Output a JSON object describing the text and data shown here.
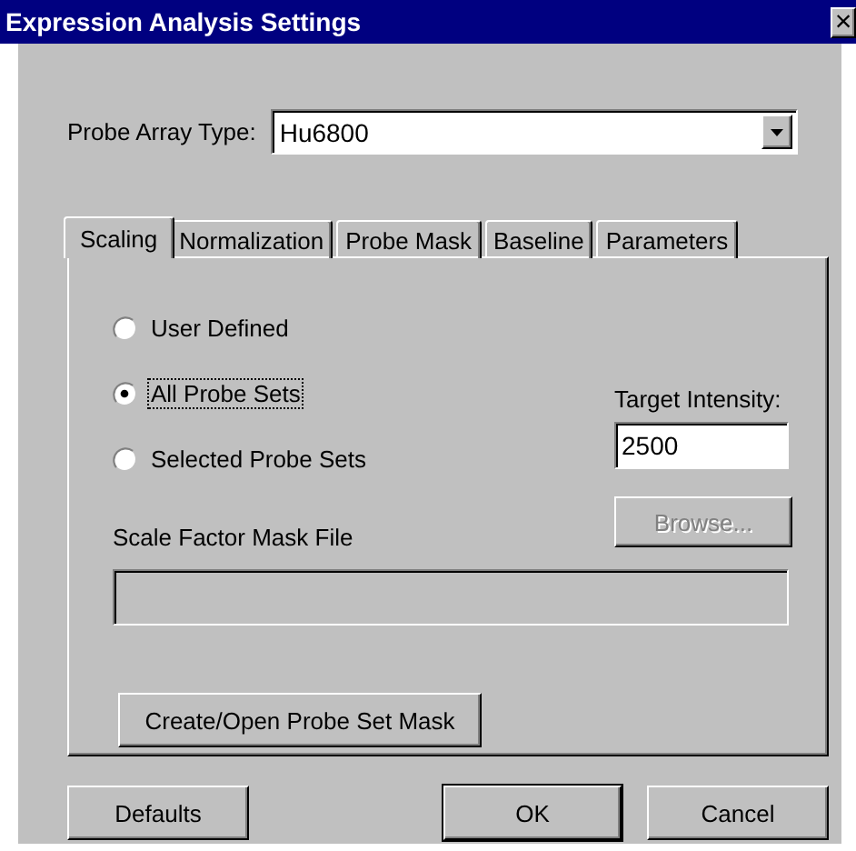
{
  "window": {
    "title": "Expression Analysis Settings",
    "close_glyph": "×"
  },
  "probe_array_type": {
    "label": "Probe Array Type:",
    "value": "Hu6800"
  },
  "tabs": [
    {
      "label": "Scaling",
      "selected": true
    },
    {
      "label": "Normalization",
      "selected": false
    },
    {
      "label": "Probe Mask",
      "selected": false
    },
    {
      "label": "Baseline",
      "selected": false
    },
    {
      "label": "Parameters",
      "selected": false
    }
  ],
  "scaling": {
    "radios": [
      {
        "label": "User Defined",
        "selected": false,
        "focused": false
      },
      {
        "label": "All Probe Sets",
        "selected": true,
        "focused": true
      },
      {
        "label": "Selected Probe Sets",
        "selected": false,
        "focused": false
      }
    ],
    "target_intensity": {
      "label": "Target Intensity:",
      "value": "2500"
    },
    "browse_button": {
      "label": "Browse...",
      "disabled": true
    },
    "mask_file": {
      "label": "Scale Factor Mask File",
      "disabled": true
    },
    "create_button": {
      "label": "Create/Open Probe Set Mask"
    }
  },
  "buttons": [
    {
      "label": "Defaults",
      "default": false
    },
    {
      "label": "OK",
      "default": true
    },
    {
      "label": "Cancel",
      "default": false
    }
  ]
}
